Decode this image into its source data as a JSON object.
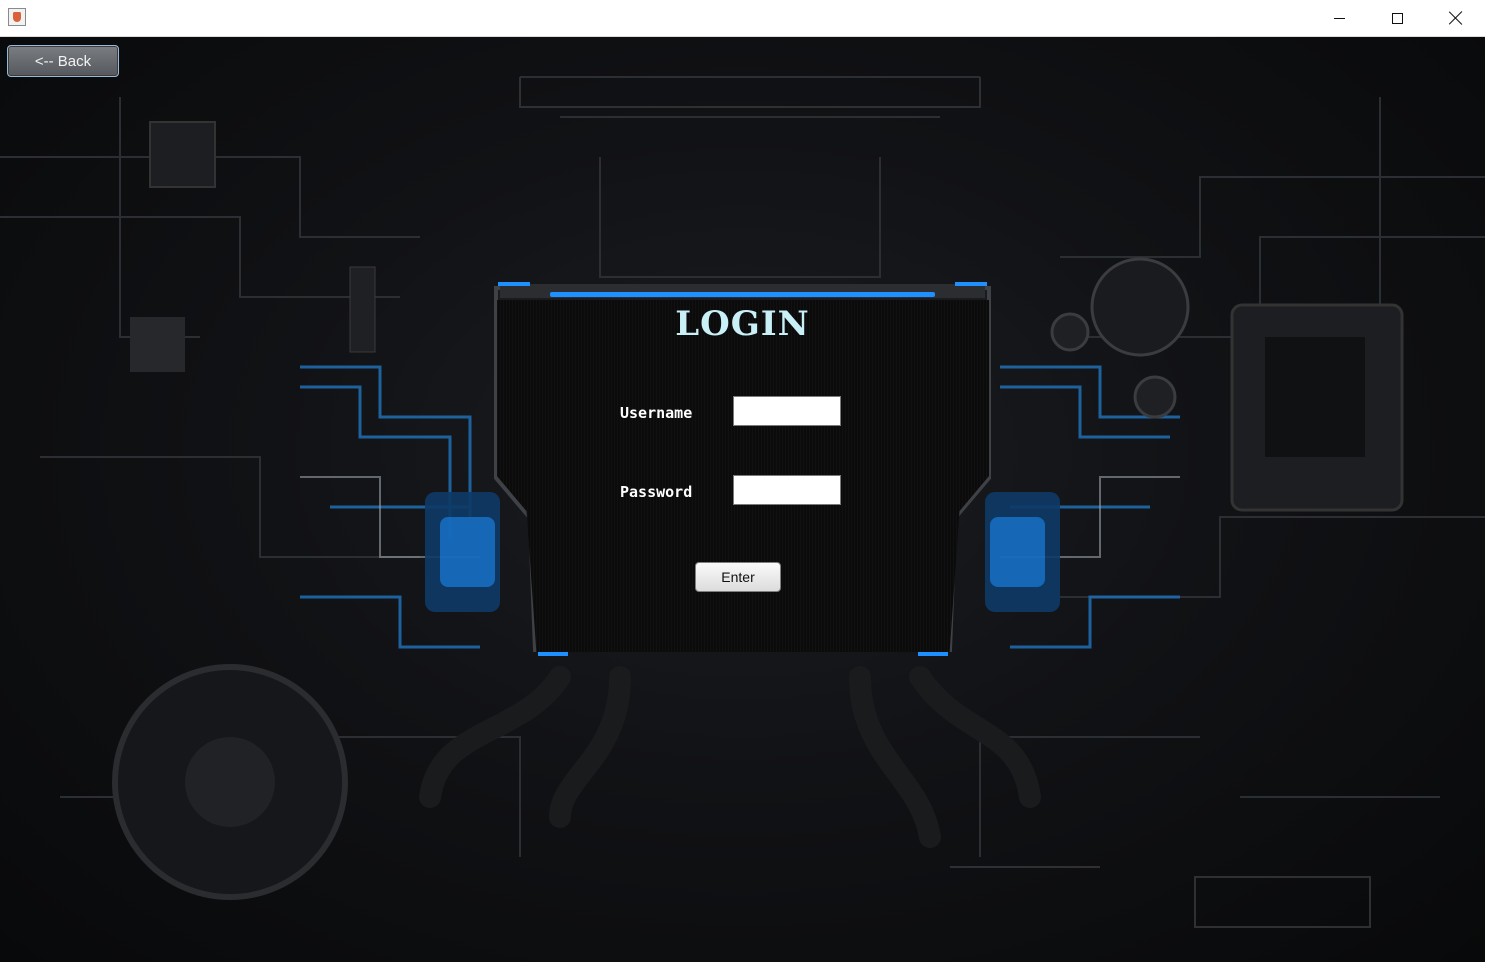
{
  "window": {
    "icon": "java-icon",
    "controls": {
      "minimize": "minimize-icon",
      "maximize": "maximize-icon",
      "close": "close-icon"
    }
  },
  "nav": {
    "back_label": "<-- Back"
  },
  "login": {
    "title": "LOGIN",
    "username_label": "Username",
    "password_label": "Password",
    "username_value": "",
    "password_value": "",
    "enter_label": "Enter"
  },
  "colors": {
    "accent_blue": "#1e90ff",
    "title_color": "#c9f0f6",
    "panel_bg": "#0b0b0c"
  }
}
